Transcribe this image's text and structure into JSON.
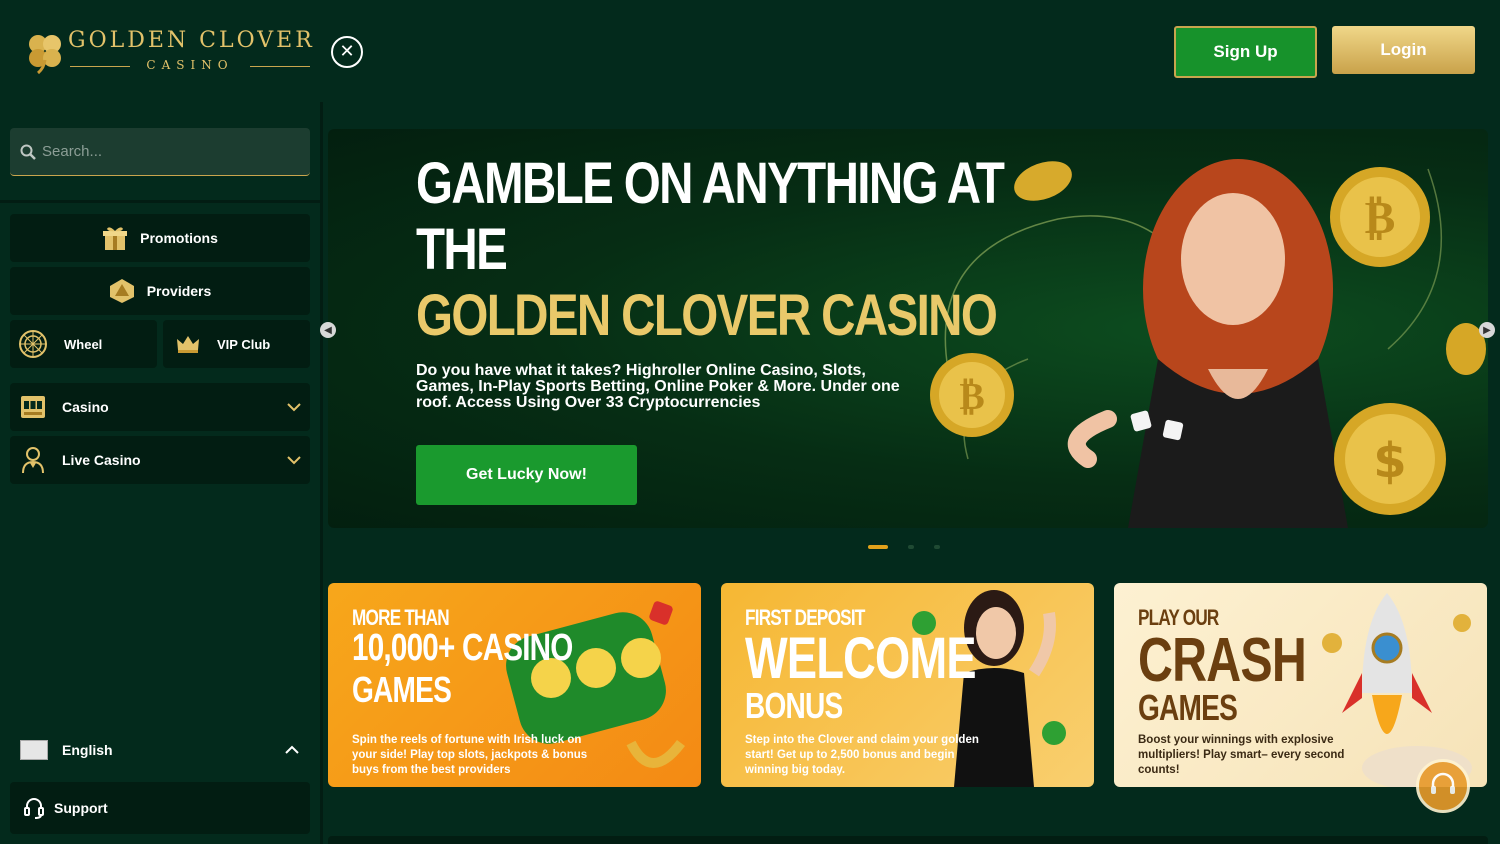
{
  "header": {
    "logo_title": "GOLDEN CLOVER",
    "logo_sub": "CASINO",
    "signup_label": "Sign Up",
    "login_label": "Login"
  },
  "sidebar": {
    "search_placeholder": "Search...",
    "promotions": "Promotions",
    "providers": "Providers",
    "wheel": "Wheel",
    "vip": "VIP Club",
    "casino": "Casino",
    "live_casino": "Live Casino",
    "language": "English",
    "support": "Support"
  },
  "hero": {
    "title_line1": "GAMBLE ON ANYTHING AT",
    "title_line2": "THE",
    "title_line3": "GOLDEN CLOVER CASINO",
    "description": "Do you have what it takes? Highroller Online Casino, Slots, Games, In-Play Sports Betting, Online Poker & More. Under one roof. Access Using Over 33 Cryptocurrencies",
    "cta": "Get Lucky Now!"
  },
  "cards": [
    {
      "t1": "MORE THAN",
      "t2": "10,000+ CASINO",
      "t3": "GAMES",
      "desc": "Spin the reels of fortune with Irish luck on your side! Play top slots, jackpots & bonus buys from the best providers"
    },
    {
      "t1": "FIRST DEPOSIT",
      "t2": "WELCOME",
      "t3": "BONUS",
      "desc": "Step into the Clover and claim your golden start! Get up to 2,500 bonus and begin winning big today."
    },
    {
      "t1": "PLAY OUR",
      "t2": "CRASH",
      "t3": "GAMES",
      "desc": "Boost your winnings with explosive multipliers! Play smart– every second counts!"
    }
  ],
  "colors": {
    "bg": "#032a1c",
    "gold": "#e2c26a",
    "green_btn": "#17922b",
    "dot_active": "#e2a21b"
  }
}
